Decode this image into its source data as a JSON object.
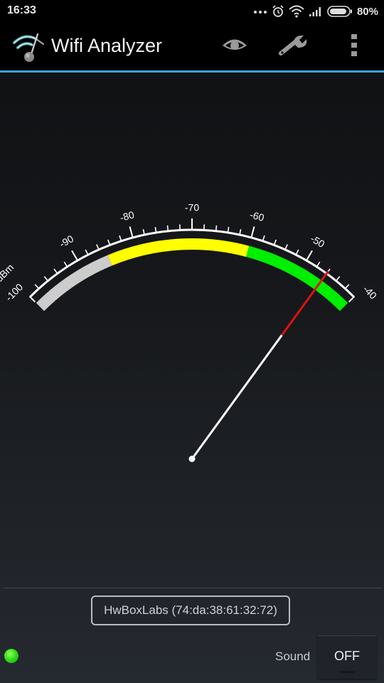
{
  "status_bar": {
    "time": "16:33",
    "icons": [
      "more-notifications-icon",
      "alarm-icon",
      "wifi-icon",
      "cell-signal-icon",
      "battery-icon"
    ],
    "battery_percent": "80%"
  },
  "action_bar": {
    "title": "Wifi Analyzer",
    "actions": [
      {
        "name": "view-icon",
        "label": "View"
      },
      {
        "name": "tools-icon",
        "label": "Tools"
      },
      {
        "name": "overflow-menu-icon",
        "label": "More options"
      }
    ],
    "accent_color": "#33a5d8"
  },
  "meter": {
    "unit": "dBm",
    "min": -100,
    "max": -40,
    "major_step": 10,
    "minor_step": 2,
    "tick_labels": [
      "-100",
      "-90",
      "-80",
      "-70",
      "-60",
      "-50",
      "-40"
    ],
    "value": -46,
    "bands": [
      {
        "from": -100,
        "to": -85,
        "color": "#cccccc"
      },
      {
        "from": -85,
        "to": -60,
        "color": "#ffff00"
      },
      {
        "from": -60,
        "to": -40,
        "color": "#00ee00"
      }
    ],
    "needle_color": "#ffffff",
    "needle_tip_color": "#dd1111"
  },
  "access_point": {
    "label": "HwBoxLabs (74:da:38:61:32:72)"
  },
  "footer": {
    "status_led_color": "#35e01a",
    "sound_label": "Sound",
    "sound_toggle": "OFF"
  }
}
